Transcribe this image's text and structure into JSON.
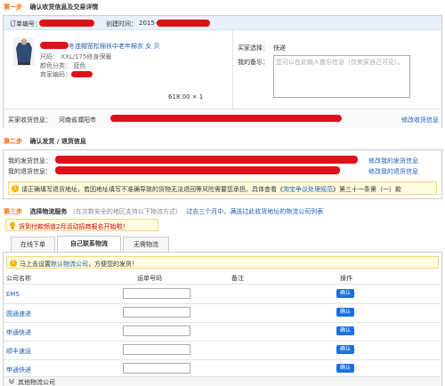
{
  "step1": {
    "num": "第一步",
    "title": "确认收货信息及交易详情",
    "order_label": "订单编号：",
    "created_label": "创建时间：",
    "created_value": "2015-",
    "product_title": "冬连帽宽松棉袄中老年棉衣 女 贝",
    "size": "尺码：  XXL/175修身保暖",
    "color": "颜色分类：  蓝色",
    "merchant_code": "商家编码：",
    "price": "618.00 × 1",
    "buyer_choice_label": "买家选择：",
    "buyer_choice_value": "快递",
    "memo_label": "我的备忘：",
    "memo_placeholder": "您可以在此输入备忘信息（仅卖家自己可见）。",
    "addr_label": "买家收货信息：",
    "addr_value": "河南省濮阳市",
    "edit_link": "修改收货信息"
  },
  "step2": {
    "num": "第二步",
    "title": "确认发货 / 退货信息",
    "ship_label": "我的发货信息：",
    "return_label": "我的退货信息：",
    "edit_ship": "修改我的发货信息",
    "edit_return": "修改我的退货信息",
    "notice": "请正确填写退货地址，若因地址填写不准确导致的货物无法退回等风险需要您承担。具体查看《",
    "notice_link": "淘宝争议处理规范",
    "notice_tail": "》第三十一条第（一）款"
  },
  "step3": {
    "num": "第三步",
    "title": "选择物流服务",
    "subtitle": "（在次数安全的地区支持以下物流方式）",
    "link": "过去三个月中，满送过此收货地址的物流公司列表",
    "promo": "货到付款频道2月活动招商报名开始啦！",
    "tabs": [
      "在线下单",
      "自己联系物流",
      "无需物流"
    ],
    "setup_text": "马上去设置",
    "setup_link": "默认物流公司",
    "setup_tail": "，方便您的发货！",
    "headers": [
      "公司名称",
      "运单号码",
      "备注",
      "操作"
    ],
    "rows": [
      {
        "name": "EMS",
        "action": "确认"
      },
      {
        "name": "圆通速递",
        "action": "确认"
      },
      {
        "name": "申通快递",
        "action": "确认"
      },
      {
        "name": "顺丰速运",
        "action": "确认"
      },
      {
        "name": "申通快递",
        "action": "确认"
      }
    ],
    "more": "其他物流公司"
  },
  "colors": {
    "accent": "#ff6600",
    "link": "#1e5fb3",
    "button": "#1a6ee0",
    "redact": "#e0101a"
  }
}
